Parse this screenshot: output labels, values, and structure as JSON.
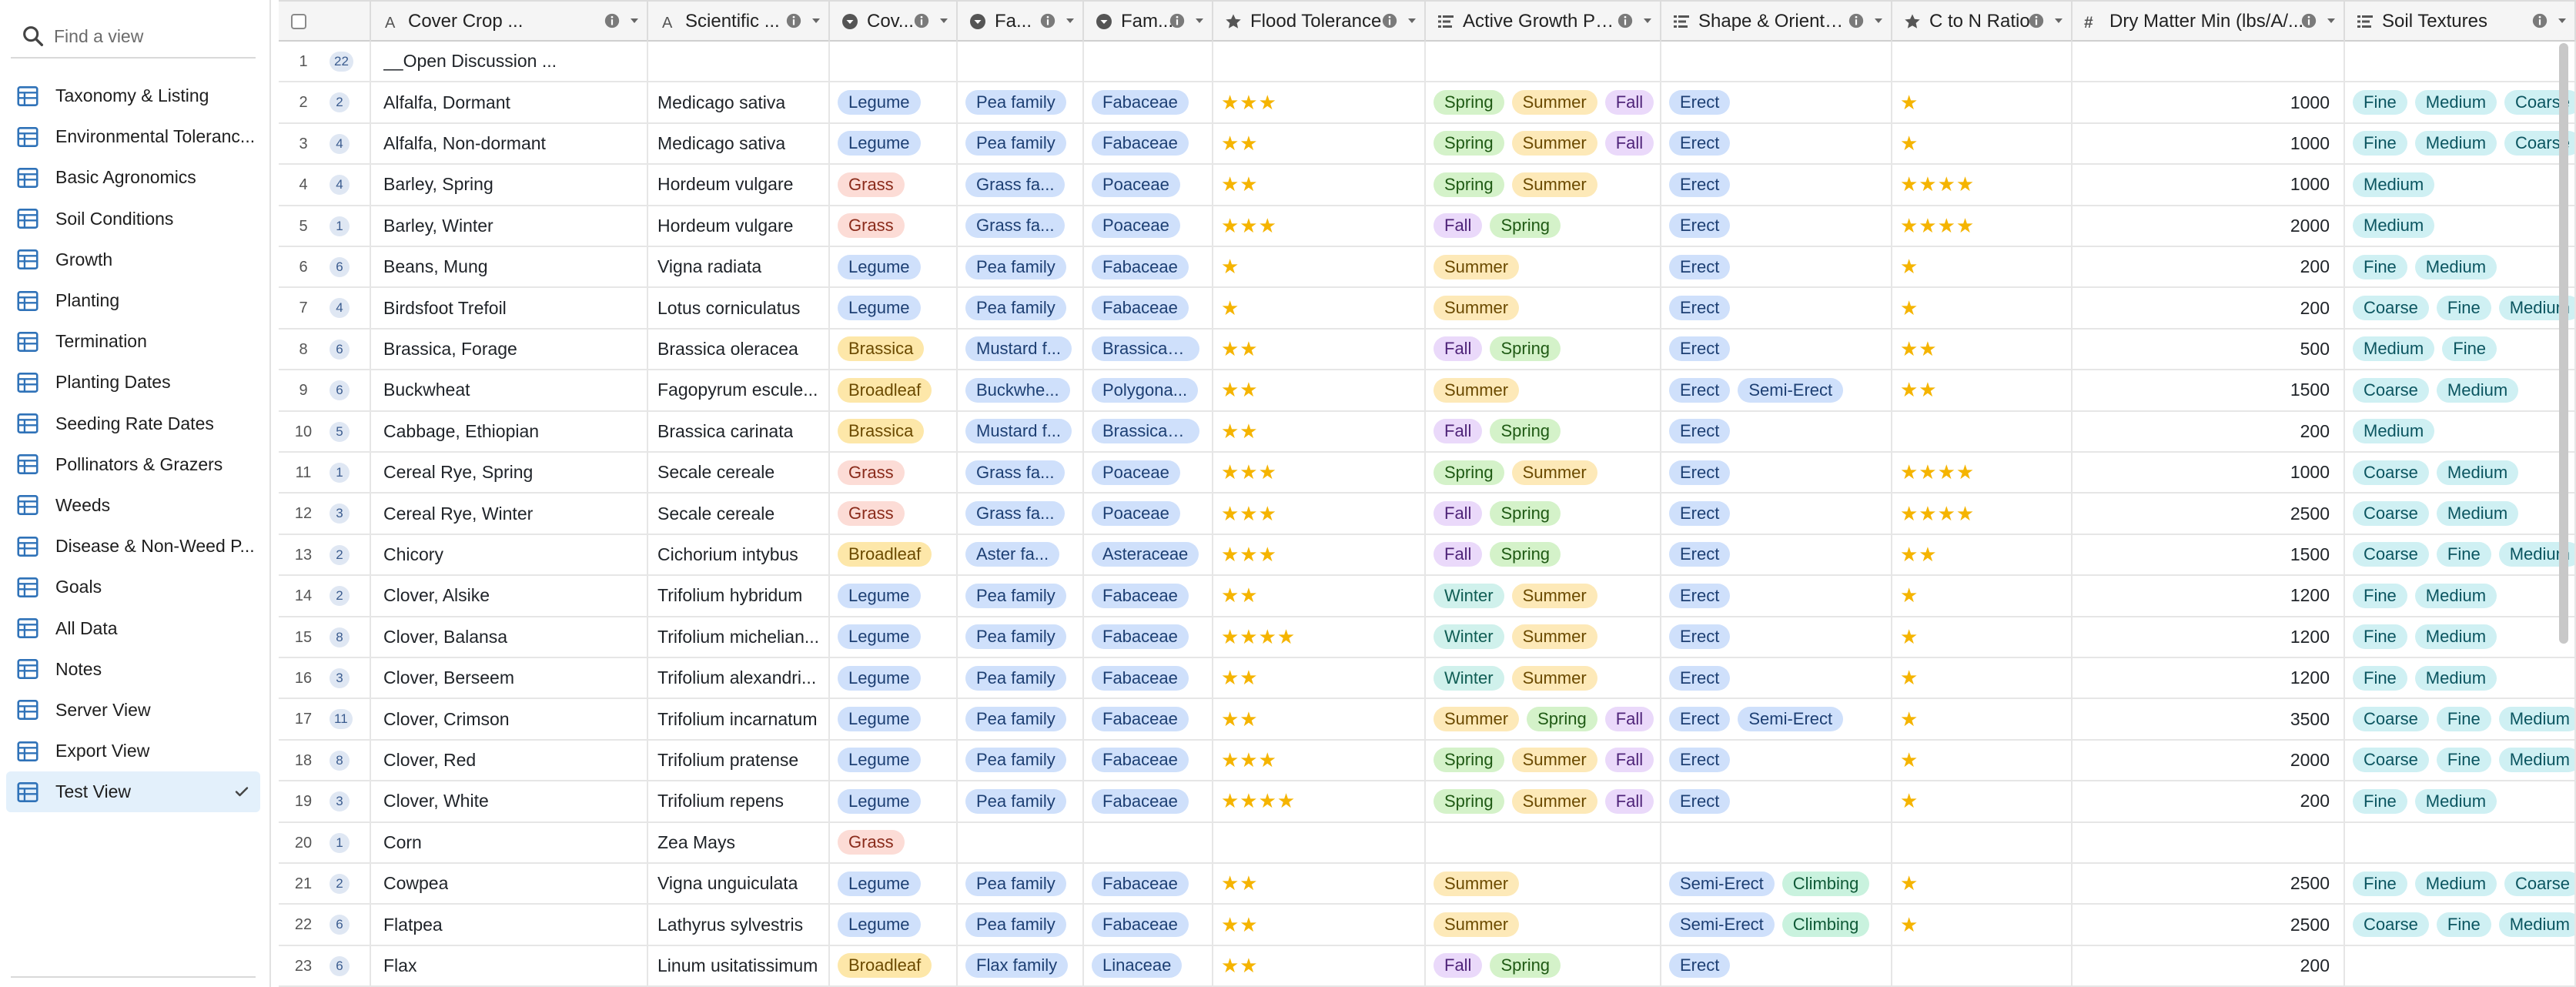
{
  "sidebar": {
    "search_placeholder": "Find a view",
    "active_index": 17,
    "items": [
      {
        "label": "Taxonomy & Listing"
      },
      {
        "label": "Environmental Toleranc..."
      },
      {
        "label": "Basic Agronomics"
      },
      {
        "label": "Soil Conditions"
      },
      {
        "label": "Growth"
      },
      {
        "label": "Planting"
      },
      {
        "label": "Termination"
      },
      {
        "label": "Planting Dates"
      },
      {
        "label": "Seeding Rate Dates"
      },
      {
        "label": "Pollinators & Grazers"
      },
      {
        "label": "Weeds"
      },
      {
        "label": "Disease & Non-Weed P..."
      },
      {
        "label": "Goals"
      },
      {
        "label": "All Data"
      },
      {
        "label": "Notes"
      },
      {
        "label": "Server View"
      },
      {
        "label": "Export View"
      },
      {
        "label": "Test View"
      }
    ]
  },
  "colors": {
    "Legume": [
      "#cfe0fb",
      "#1d3f73"
    ],
    "Grass": [
      "#fcdcd6",
      "#8a2b1b"
    ],
    "Brassica": [
      "#fde7a9",
      "#6b4a00"
    ],
    "Broadleaf": [
      "#fde7a9",
      "#6b4a00"
    ],
    "family": [
      "#cfe0fb",
      "#1d3f73"
    ],
    "season_Spring": [
      "#d4f2c9",
      "#1f5a14"
    ],
    "season_Summer": [
      "#fde9b8",
      "#6b4a00"
    ],
    "season_Fall": [
      "#ead9fa",
      "#4f2479"
    ],
    "season_Winter": [
      "#d0f1ec",
      "#0f5d54"
    ],
    "shape": [
      "#cfe0fb",
      "#1d3f73"
    ],
    "shape_Climbing": [
      "#c9f2de",
      "#0f5a37"
    ],
    "soil": [
      "#cff0f3",
      "#0b5560"
    ],
    "star": "#f5b400"
  },
  "columns": [
    {
      "key": "name",
      "label": "Cover Crop ...",
      "type": "text",
      "info": true
    },
    {
      "key": "sci",
      "label": "Scientific ...",
      "type": "text",
      "info": true
    },
    {
      "key": "group",
      "label": "Cov...",
      "type": "select",
      "info": true
    },
    {
      "key": "family",
      "label": "Fa...",
      "type": "select",
      "info": true
    },
    {
      "key": "fam2",
      "label": "Fam...",
      "type": "select",
      "info": true
    },
    {
      "key": "flood",
      "label": "Flood Tolerance",
      "type": "rating",
      "info": true
    },
    {
      "key": "growth",
      "label": "Active Growth Period",
      "type": "multi",
      "info": true
    },
    {
      "key": "shape",
      "label": "Shape & Orientat...",
      "type": "multi",
      "info": true
    },
    {
      "key": "cn",
      "label": "C to N Ratio",
      "type": "rating",
      "info": true
    },
    {
      "key": "dm",
      "label": "Dry Matter Min (lbs/A/...",
      "type": "number",
      "info": true
    },
    {
      "key": "soil",
      "label": "Soil Textures",
      "type": "multi",
      "info": true
    }
  ],
  "rows": [
    {
      "n": "1",
      "count": "22",
      "name": "__Open Discussion ...",
      "sci": "",
      "group": "",
      "family": "",
      "fam2": "",
      "flood": 0,
      "growth": [],
      "shape": [],
      "cn": 0,
      "dm": "",
      "soil": []
    },
    {
      "n": "2",
      "count": "2",
      "name": "Alfalfa, Dormant",
      "sci": "Medicago sativa",
      "group": "Legume",
      "family": "Pea family",
      "fam2": "Fabaceae",
      "flood": 3,
      "growth": [
        "Spring",
        "Summer",
        "Fall"
      ],
      "shape": [
        "Erect"
      ],
      "cn": 1,
      "dm": "1000",
      "soil": [
        "Fine",
        "Medium",
        "Coarse"
      ]
    },
    {
      "n": "3",
      "count": "4",
      "name": "Alfalfa, Non-dormant",
      "sci": "Medicago sativa",
      "group": "Legume",
      "family": "Pea family",
      "fam2": "Fabaceae",
      "flood": 2,
      "growth": [
        "Spring",
        "Summer",
        "Fall"
      ],
      "shape": [
        "Erect"
      ],
      "cn": 1,
      "dm": "1000",
      "soil": [
        "Fine",
        "Medium",
        "Coarse"
      ]
    },
    {
      "n": "4",
      "count": "4",
      "name": "Barley, Spring",
      "sci": "Hordeum vulgare",
      "group": "Grass",
      "family": "Grass fa...",
      "fam2": "Poaceae",
      "flood": 2,
      "growth": [
        "Spring",
        "Summer"
      ],
      "shape": [
        "Erect"
      ],
      "cn": 4,
      "dm": "1000",
      "soil": [
        "Medium"
      ]
    },
    {
      "n": "5",
      "count": "1",
      "name": "Barley, Winter",
      "sci": "Hordeum vulgare",
      "group": "Grass",
      "family": "Grass fa...",
      "fam2": "Poaceae",
      "flood": 3,
      "growth": [
        "Fall",
        "Spring"
      ],
      "shape": [
        "Erect"
      ],
      "cn": 4,
      "dm": "2000",
      "soil": [
        "Medium"
      ]
    },
    {
      "n": "6",
      "count": "6",
      "name": "Beans, Mung",
      "sci": "Vigna radiata",
      "group": "Legume",
      "family": "Pea family",
      "fam2": "Fabaceae",
      "flood": 1,
      "growth": [
        "Summer"
      ],
      "shape": [
        "Erect"
      ],
      "cn": 1,
      "dm": "200",
      "soil": [
        "Fine",
        "Medium"
      ]
    },
    {
      "n": "7",
      "count": "4",
      "name": "Birdsfoot Trefoil",
      "sci": "Lotus corniculatus",
      "group": "Legume",
      "family": "Pea family",
      "fam2": "Fabaceae",
      "flood": 1,
      "growth": [
        "Summer"
      ],
      "shape": [
        "Erect"
      ],
      "cn": 1,
      "dm": "200",
      "soil": [
        "Coarse",
        "Fine",
        "Medium"
      ]
    },
    {
      "n": "8",
      "count": "6",
      "name": "Brassica, Forage",
      "sci": "Brassica oleracea",
      "group": "Brassica",
      "family": "Mustard f...",
      "fam2": "Brassicac...",
      "flood": 2,
      "growth": [
        "Fall",
        "Spring"
      ],
      "shape": [
        "Erect"
      ],
      "cn": 2,
      "dm": "500",
      "soil": [
        "Medium",
        "Fine"
      ]
    },
    {
      "n": "9",
      "count": "6",
      "name": "Buckwheat",
      "sci": "Fagopyrum escule...",
      "group": "Broadleaf",
      "family": "Buckwhe...",
      "fam2": "Polygona...",
      "flood": 2,
      "growth": [
        "Summer"
      ],
      "shape": [
        "Erect",
        "Semi-Erect"
      ],
      "cn": 2,
      "dm": "1500",
      "soil": [
        "Coarse",
        "Medium"
      ]
    },
    {
      "n": "10",
      "count": "5",
      "name": "Cabbage, Ethiopian",
      "sci": "Brassica carinata",
      "group": "Brassica",
      "family": "Mustard f...",
      "fam2": "Brassicac...",
      "flood": 2,
      "growth": [
        "Fall",
        "Spring"
      ],
      "shape": [
        "Erect"
      ],
      "cn": 0,
      "dm": "200",
      "soil": [
        "Medium"
      ]
    },
    {
      "n": "11",
      "count": "1",
      "name": "Cereal Rye, Spring",
      "sci": "Secale cereale",
      "group": "Grass",
      "family": "Grass fa...",
      "fam2": "Poaceae",
      "flood": 3,
      "growth": [
        "Spring",
        "Summer"
      ],
      "shape": [
        "Erect"
      ],
      "cn": 4,
      "dm": "1000",
      "soil": [
        "Coarse",
        "Medium"
      ]
    },
    {
      "n": "12",
      "count": "3",
      "name": "Cereal Rye, Winter",
      "sci": "Secale cereale",
      "group": "Grass",
      "family": "Grass fa...",
      "fam2": "Poaceae",
      "flood": 3,
      "growth": [
        "Fall",
        "Spring"
      ],
      "shape": [
        "Erect"
      ],
      "cn": 4,
      "dm": "2500",
      "soil": [
        "Coarse",
        "Medium"
      ]
    },
    {
      "n": "13",
      "count": "2",
      "name": "Chicory",
      "sci": "Cichorium intybus",
      "group": "Broadleaf",
      "family": "Aster fa...",
      "fam2": "Asteraceae",
      "flood": 3,
      "growth": [
        "Fall",
        "Spring"
      ],
      "shape": [
        "Erect"
      ],
      "cn": 2,
      "dm": "1500",
      "soil": [
        "Coarse",
        "Fine",
        "Medium"
      ]
    },
    {
      "n": "14",
      "count": "2",
      "name": "Clover, Alsike",
      "sci": "Trifolium hybridum",
      "group": "Legume",
      "family": "Pea family",
      "fam2": "Fabaceae",
      "flood": 2,
      "growth": [
        "Winter",
        "Summer"
      ],
      "shape": [
        "Erect"
      ],
      "cn": 1,
      "dm": "1200",
      "soil": [
        "Fine",
        "Medium"
      ]
    },
    {
      "n": "15",
      "count": "8",
      "name": "Clover, Balansa",
      "sci": "Trifolium michelian...",
      "group": "Legume",
      "family": "Pea family",
      "fam2": "Fabaceae",
      "flood": 4,
      "growth": [
        "Winter",
        "Summer"
      ],
      "shape": [
        "Erect"
      ],
      "cn": 1,
      "dm": "1200",
      "soil": [
        "Fine",
        "Medium"
      ]
    },
    {
      "n": "16",
      "count": "3",
      "name": "Clover, Berseem",
      "sci": "Trifolium alexandri...",
      "group": "Legume",
      "family": "Pea family",
      "fam2": "Fabaceae",
      "flood": 2,
      "growth": [
        "Winter",
        "Summer"
      ],
      "shape": [
        "Erect"
      ],
      "cn": 1,
      "dm": "1200",
      "soil": [
        "Fine",
        "Medium"
      ]
    },
    {
      "n": "17",
      "count": "11",
      "name": "Clover, Crimson",
      "sci": "Trifolium incarnatum",
      "group": "Legume",
      "family": "Pea family",
      "fam2": "Fabaceae",
      "flood": 2,
      "growth": [
        "Summer",
        "Spring",
        "Fall"
      ],
      "shape": [
        "Erect",
        "Semi-Erect"
      ],
      "cn": 1,
      "dm": "3500",
      "soil": [
        "Coarse",
        "Fine",
        "Medium"
      ]
    },
    {
      "n": "18",
      "count": "8",
      "name": "Clover, Red",
      "sci": "Trifolium pratense",
      "group": "Legume",
      "family": "Pea family",
      "fam2": "Fabaceae",
      "flood": 3,
      "growth": [
        "Spring",
        "Summer",
        "Fall"
      ],
      "shape": [
        "Erect"
      ],
      "cn": 1,
      "dm": "2000",
      "soil": [
        "Coarse",
        "Fine",
        "Medium"
      ]
    },
    {
      "n": "19",
      "count": "3",
      "name": "Clover, White",
      "sci": "Trifolium repens",
      "group": "Legume",
      "family": "Pea family",
      "fam2": "Fabaceae",
      "flood": 4,
      "growth": [
        "Spring",
        "Summer",
        "Fall"
      ],
      "shape": [
        "Erect"
      ],
      "cn": 1,
      "dm": "200",
      "soil": [
        "Fine",
        "Medium"
      ]
    },
    {
      "n": "20",
      "count": "1",
      "name": "Corn",
      "sci": "Zea Mays",
      "group": "Grass",
      "family": "",
      "fam2": "",
      "flood": 0,
      "growth": [],
      "shape": [],
      "cn": 0,
      "dm": "",
      "soil": []
    },
    {
      "n": "21",
      "count": "2",
      "name": "Cowpea",
      "sci": "Vigna unguiculata",
      "group": "Legume",
      "family": "Pea family",
      "fam2": "Fabaceae",
      "flood": 2,
      "growth": [
        "Summer"
      ],
      "shape": [
        "Semi-Erect",
        "Climbing"
      ],
      "cn": 1,
      "dm": "2500",
      "soil": [
        "Fine",
        "Medium",
        "Coarse"
      ]
    },
    {
      "n": "22",
      "count": "6",
      "name": "Flatpea",
      "sci": "Lathyrus sylvestris",
      "group": "Legume",
      "family": "Pea family",
      "fam2": "Fabaceae",
      "flood": 2,
      "growth": [
        "Summer"
      ],
      "shape": [
        "Semi-Erect",
        "Climbing"
      ],
      "cn": 1,
      "dm": "2500",
      "soil": [
        "Coarse",
        "Fine",
        "Medium"
      ]
    },
    {
      "n": "23",
      "count": "6",
      "name": "Flax",
      "sci": "Linum usitatissimum",
      "group": "Broadleaf",
      "family": "Flax family",
      "fam2": "Linaceae",
      "flood": 2,
      "growth": [
        "Fall",
        "Spring"
      ],
      "shape": [
        "Erect"
      ],
      "cn": 0,
      "dm": "200",
      "soil": []
    }
  ]
}
